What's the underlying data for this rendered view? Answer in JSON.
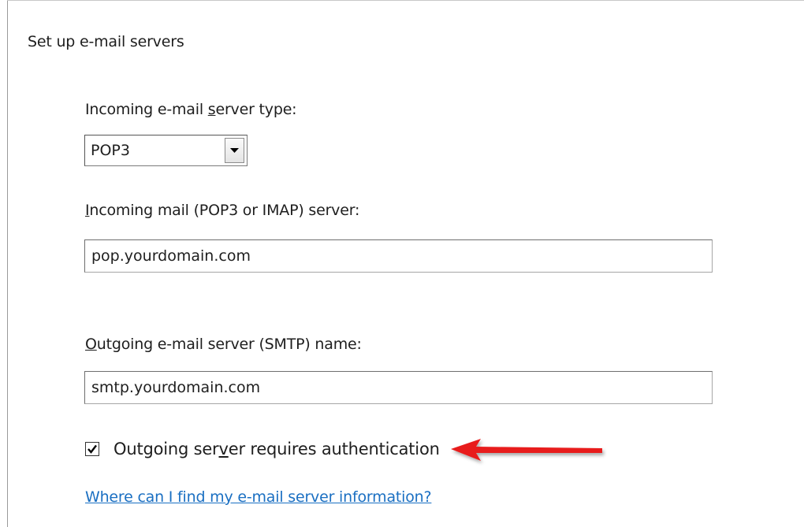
{
  "section": {
    "title": "Set up e-mail servers"
  },
  "incoming_type": {
    "label_prefix": "Incoming e-mail ",
    "label_accel": "s",
    "label_suffix": "erver type:",
    "selected": "POP3"
  },
  "incoming_server": {
    "label_accel": "I",
    "label_rest": "ncoming mail (POP3 or IMAP) server:",
    "value": "pop.yourdomain.com"
  },
  "outgoing_server": {
    "label_accel": "O",
    "label_rest": "utgoing e-mail server (SMTP) name:",
    "value": "smtp.yourdomain.com"
  },
  "auth": {
    "label_prefix": "Outgoing ser",
    "label_accel": "v",
    "label_suffix": "er requires authentication",
    "checked": true
  },
  "help_link": {
    "text": "Where can I find my e-mail server information?"
  },
  "colors": {
    "link": "#1a6fc2",
    "arrow": "#e81f1f"
  }
}
